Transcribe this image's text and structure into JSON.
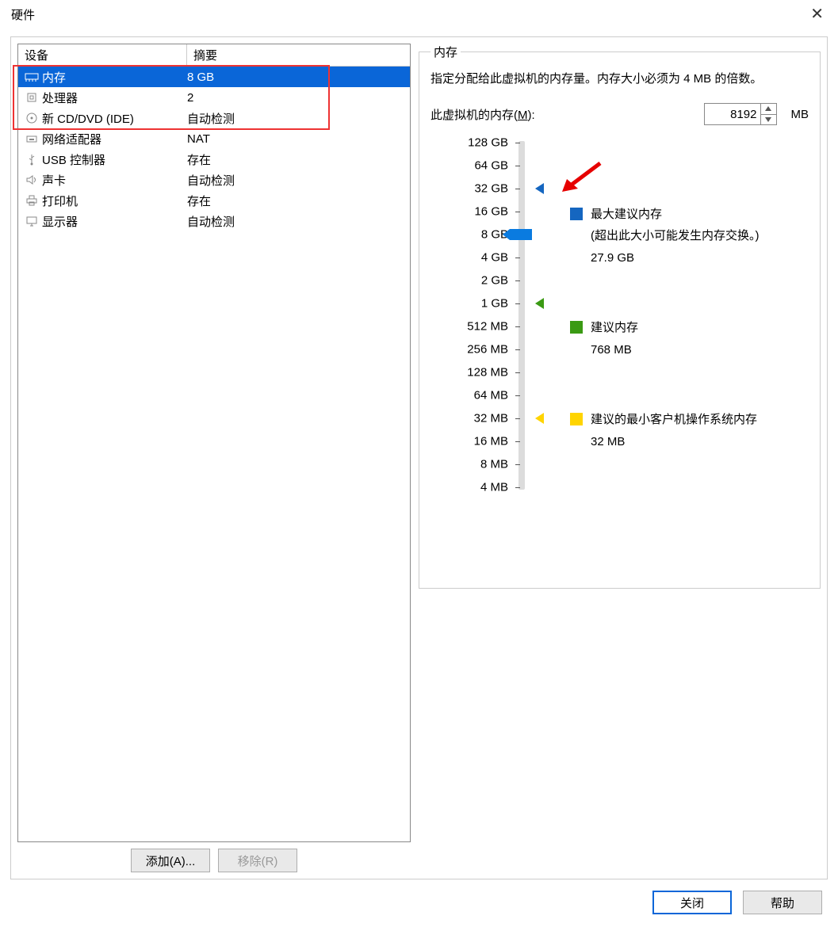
{
  "window": {
    "title": "硬件"
  },
  "left": {
    "header_device": "设备",
    "header_summary": "摘要",
    "rows": [
      {
        "name": "内存",
        "summary": "8 GB",
        "selected": true,
        "icon": "memory"
      },
      {
        "name": "处理器",
        "summary": "2",
        "icon": "cpu"
      },
      {
        "name": "新 CD/DVD (IDE)",
        "summary": "自动检测",
        "icon": "disc"
      },
      {
        "name": "网络适配器",
        "summary": "NAT",
        "icon": "net"
      },
      {
        "name": "USB 控制器",
        "summary": "存在",
        "icon": "usb"
      },
      {
        "name": "声卡",
        "summary": "自动检测",
        "icon": "sound"
      },
      {
        "name": "打印机",
        "summary": "存在",
        "icon": "printer"
      },
      {
        "name": "显示器",
        "summary": "自动检测",
        "icon": "display"
      }
    ],
    "buttons": {
      "add": "添加(A)...",
      "remove": "移除(R)"
    }
  },
  "right": {
    "group_title": "内存",
    "description": "指定分配给此虚拟机的内存量。内存大小必须为 4 MB 的倍数。",
    "input_label_prefix": "此虚拟机的内存(",
    "input_label_hotkey": "M",
    "input_label_suffix": "):",
    "input_value": "8192",
    "input_unit": "MB",
    "ticks": [
      "128 GB",
      "64 GB",
      "32 GB",
      "16 GB",
      "8 GB",
      "4 GB",
      "2 GB",
      "1 GB",
      "512 MB",
      "256 MB",
      "128 MB",
      "64 MB",
      "32 MB",
      "16 MB",
      "8 MB",
      "4 MB"
    ],
    "legend": {
      "max": {
        "title": "最大建议内存",
        "sub": "(超出此大小可能发生内存交换。)",
        "value": "27.9 GB",
        "color": "#1566c0"
      },
      "rec": {
        "title": "建议内存",
        "value": "768 MB",
        "color": "#3a9a13"
      },
      "min": {
        "title": "建议的最小客户机操作系统内存",
        "value": "32 MB",
        "color": "#ffd400"
      }
    },
    "current_tick_index": 4,
    "max_marker_tick_index": 2,
    "rec_marker_tick_index": 7,
    "min_marker_tick_index": 12
  },
  "dialog_buttons": {
    "close": "关闭",
    "help": "帮助"
  }
}
